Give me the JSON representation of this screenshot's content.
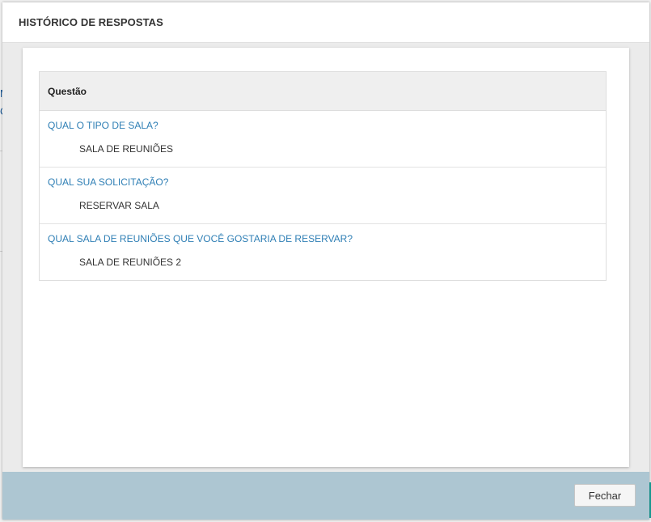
{
  "modal": {
    "title": "HISTÓRICO DE RESPOSTAS"
  },
  "table": {
    "header": "Questão",
    "rows": [
      {
        "question": "QUAL O TIPO DE SALA?",
        "answer": "SALA DE REUNIÕES"
      },
      {
        "question": "QUAL SUA SOLICITAÇÃO?",
        "answer": "RESERVAR SALA"
      },
      {
        "question": "QUAL SALA DE REUNIÕES QUE VOCÊ GOSTARIA DE RESERVAR?",
        "answer": "SALA DE REUNIÕES 2"
      }
    ]
  },
  "footer": {
    "close_label": "Fechar"
  },
  "colors": {
    "question_link": "#2f7fb5",
    "footer_bg": "#adc6d2",
    "header_row_bg": "#efefef"
  }
}
